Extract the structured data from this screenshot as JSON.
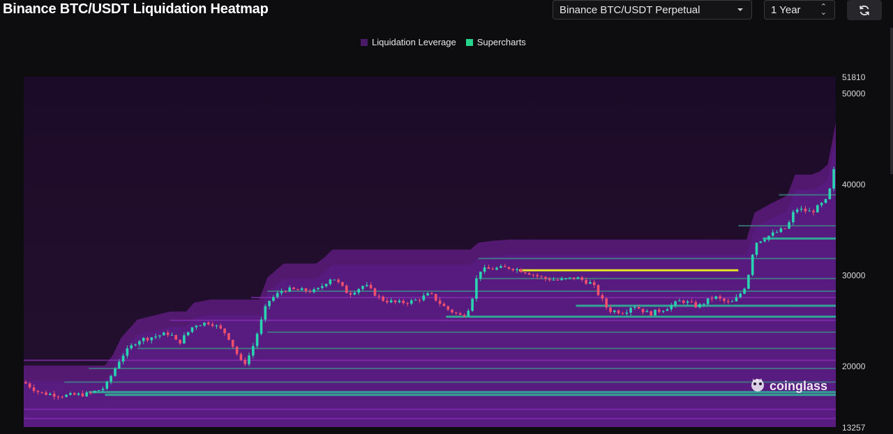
{
  "header": {
    "title": "Binance BTC/USDT Liquidation Heatmap",
    "symbol_select": "Binance BTC/USDT Perpetual",
    "range_select": "1 Year"
  },
  "legend": [
    {
      "label": "Liquidation Leverage",
      "color": "#4b1a66"
    },
    {
      "label": "Supercharts",
      "color": "#26d38a"
    }
  ],
  "watermark": "coinglass",
  "colors": {
    "background": "#0d0d0f",
    "heat_low": "#2a0f3c",
    "heat_mid": "#7d23a8",
    "heat_high": "#2fb59a",
    "heat_peak": "#e6e62a",
    "candle_up": "#2bd4b0",
    "candle_down": "#f0506e"
  },
  "chart_data": {
    "type": "heatmap",
    "title": "Binance BTC/USDT Liquidation Heatmap",
    "y_axis": {
      "min": 13257,
      "max": 51810,
      "ticks": [
        51810,
        50000,
        40000,
        30000,
        20000,
        13257
      ]
    },
    "price_path": [
      {
        "t": 0.0,
        "price": 18200
      },
      {
        "t": 0.02,
        "price": 17000
      },
      {
        "t": 0.05,
        "price": 16700
      },
      {
        "t": 0.08,
        "price": 16900
      },
      {
        "t": 0.1,
        "price": 17600
      },
      {
        "t": 0.12,
        "price": 21000
      },
      {
        "t": 0.14,
        "price": 22800
      },
      {
        "t": 0.16,
        "price": 23200
      },
      {
        "t": 0.18,
        "price": 23600
      },
      {
        "t": 0.19,
        "price": 22400
      },
      {
        "t": 0.21,
        "price": 24500
      },
      {
        "t": 0.23,
        "price": 24800
      },
      {
        "t": 0.25,
        "price": 23500
      },
      {
        "t": 0.27,
        "price": 20000
      },
      {
        "t": 0.28,
        "price": 21500
      },
      {
        "t": 0.3,
        "price": 27000
      },
      {
        "t": 0.32,
        "price": 28400
      },
      {
        "t": 0.34,
        "price": 28300
      },
      {
        "t": 0.36,
        "price": 28200
      },
      {
        "t": 0.38,
        "price": 29800
      },
      {
        "t": 0.4,
        "price": 27900
      },
      {
        "t": 0.42,
        "price": 28900
      },
      {
        "t": 0.44,
        "price": 27300
      },
      {
        "t": 0.46,
        "price": 26900
      },
      {
        "t": 0.48,
        "price": 27100
      },
      {
        "t": 0.5,
        "price": 27900
      },
      {
        "t": 0.52,
        "price": 26300
      },
      {
        "t": 0.54,
        "price": 25400
      },
      {
        "t": 0.55,
        "price": 26600
      },
      {
        "t": 0.56,
        "price": 30500
      },
      {
        "t": 0.58,
        "price": 30700
      },
      {
        "t": 0.6,
        "price": 30800
      },
      {
        "t": 0.62,
        "price": 30300
      },
      {
        "t": 0.64,
        "price": 29600
      },
      {
        "t": 0.66,
        "price": 29400
      },
      {
        "t": 0.68,
        "price": 29700
      },
      {
        "t": 0.7,
        "price": 29000
      },
      {
        "t": 0.72,
        "price": 26100
      },
      {
        "t": 0.74,
        "price": 25900
      },
      {
        "t": 0.75,
        "price": 26700
      },
      {
        "t": 0.77,
        "price": 25700
      },
      {
        "t": 0.79,
        "price": 26300
      },
      {
        "t": 0.81,
        "price": 27200
      },
      {
        "t": 0.83,
        "price": 26500
      },
      {
        "t": 0.85,
        "price": 27600
      },
      {
        "t": 0.87,
        "price": 26800
      },
      {
        "t": 0.88,
        "price": 27600
      },
      {
        "t": 0.89,
        "price": 29000
      },
      {
        "t": 0.9,
        "price": 33500
      },
      {
        "t": 0.92,
        "price": 34400
      },
      {
        "t": 0.94,
        "price": 35200
      },
      {
        "t": 0.95,
        "price": 37300
      },
      {
        "t": 0.97,
        "price": 36900
      },
      {
        "t": 0.99,
        "price": 38300
      },
      {
        "t": 1.0,
        "price": 42500
      }
    ],
    "liquidation_bands": [
      {
        "price": 30500,
        "start": 0.61,
        "end": 0.88,
        "level": "peak"
      },
      {
        "price": 34000,
        "start": 0.91,
        "end": 1.0,
        "level": "high"
      },
      {
        "price": 25400,
        "start": 0.52,
        "end": 1.0,
        "level": "high"
      },
      {
        "price": 26600,
        "start": 0.68,
        "end": 1.0,
        "level": "high"
      },
      {
        "price": 17100,
        "start": 0.08,
        "end": 1.0,
        "level": "high"
      },
      {
        "price": 16800,
        "start": 0.1,
        "end": 1.0,
        "level": "high"
      },
      {
        "price": 18200,
        "start": 0.05,
        "end": 1.0,
        "level": "mid"
      },
      {
        "price": 19700,
        "start": 0.08,
        "end": 1.0,
        "level": "mid"
      },
      {
        "price": 21900,
        "start": 0.14,
        "end": 1.0,
        "level": "mid"
      },
      {
        "price": 23700,
        "start": 0.3,
        "end": 1.0,
        "level": "mid"
      },
      {
        "price": 28200,
        "start": 0.3,
        "end": 1.0,
        "level": "mid"
      },
      {
        "price": 29600,
        "start": 0.56,
        "end": 1.0,
        "level": "mid"
      },
      {
        "price": 31800,
        "start": 0.56,
        "end": 1.0,
        "level": "mid"
      },
      {
        "price": 35400,
        "start": 0.88,
        "end": 1.0,
        "level": "mid"
      },
      {
        "price": 38800,
        "start": 0.93,
        "end": 1.0,
        "level": "mid"
      },
      {
        "price": 15200,
        "start": 0.0,
        "end": 1.0,
        "level": "low"
      },
      {
        "price": 14200,
        "start": 0.0,
        "end": 1.0,
        "level": "low"
      },
      {
        "price": 20600,
        "start": 0.0,
        "end": 1.0,
        "level": "low"
      },
      {
        "price": 25000,
        "start": 0.18,
        "end": 1.0,
        "level": "low"
      },
      {
        "price": 27500,
        "start": 0.28,
        "end": 1.0,
        "level": "low"
      }
    ],
    "grid": false,
    "legend_position": "top-center"
  }
}
